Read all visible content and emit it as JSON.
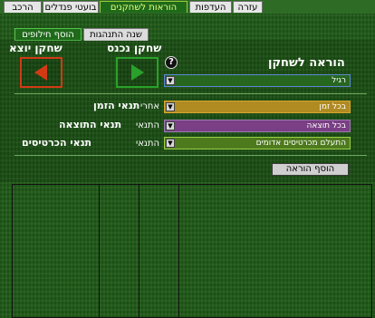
{
  "tabs": [
    {
      "label": "עזרה"
    },
    {
      "label": "העדפות"
    },
    {
      "label": "הוראות לשחקנים"
    },
    {
      "label": "בועטי פנדלים"
    },
    {
      "label": "הרכב"
    }
  ],
  "subtabs": [
    {
      "label": "הוסף חילופים"
    },
    {
      "label": "שנה התנהגות"
    }
  ],
  "substitution": {
    "player_out_label": "שחקן יוצא",
    "player_in_label": "שחקן נכנס",
    "instruction_label": "הוראה לשחקן",
    "help_glyph": "?",
    "instruction_value": "רגיל"
  },
  "conditions": {
    "time": {
      "label": "תנאי הזמן",
      "prefix": "אחרי",
      "value": "בכל זמן"
    },
    "result": {
      "label": "תנאי התוצאה",
      "prefix": "התנאי",
      "value": "בכל תוצאה"
    },
    "cards": {
      "label": "תנאי הכרטיסים",
      "prefix": "התנאי",
      "value": "התעלם מכרטיסים אדומים"
    }
  },
  "add_button_label": "הוסף הוראה",
  "colors": {
    "out_arrow": "#d23a16",
    "in_arrow": "#2aa12a",
    "active_tab_text": "#e8ff7a"
  }
}
